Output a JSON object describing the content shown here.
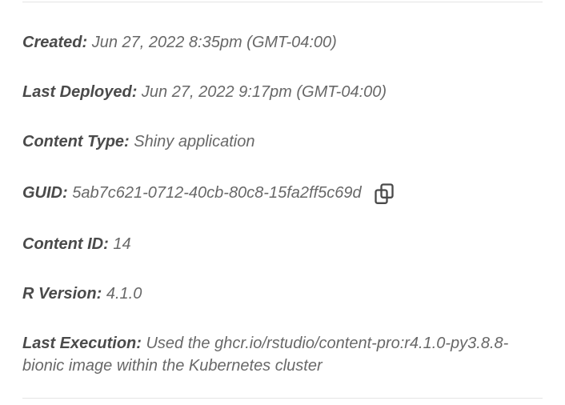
{
  "fields": {
    "created": {
      "label": "Created:",
      "value": "Jun 27, 2022 8:35pm (GMT-04:00)"
    },
    "last_deployed": {
      "label": "Last Deployed:",
      "value": "Jun 27, 2022 9:17pm (GMT-04:00)"
    },
    "content_type": {
      "label": "Content Type:",
      "value": "Shiny application"
    },
    "guid": {
      "label": "GUID:",
      "value": "5ab7c621-0712-40cb-80c8-15fa2ff5c69d"
    },
    "content_id": {
      "label": "Content ID:",
      "value": "14"
    },
    "r_version": {
      "label": "R Version:",
      "value": "4.1.0"
    },
    "last_execution": {
      "label": "Last Execution:",
      "value": "Used the ghcr.io/rstudio/content-pro:r4.1.0-py3.8.8-bionic image within the Kubernetes cluster"
    }
  }
}
